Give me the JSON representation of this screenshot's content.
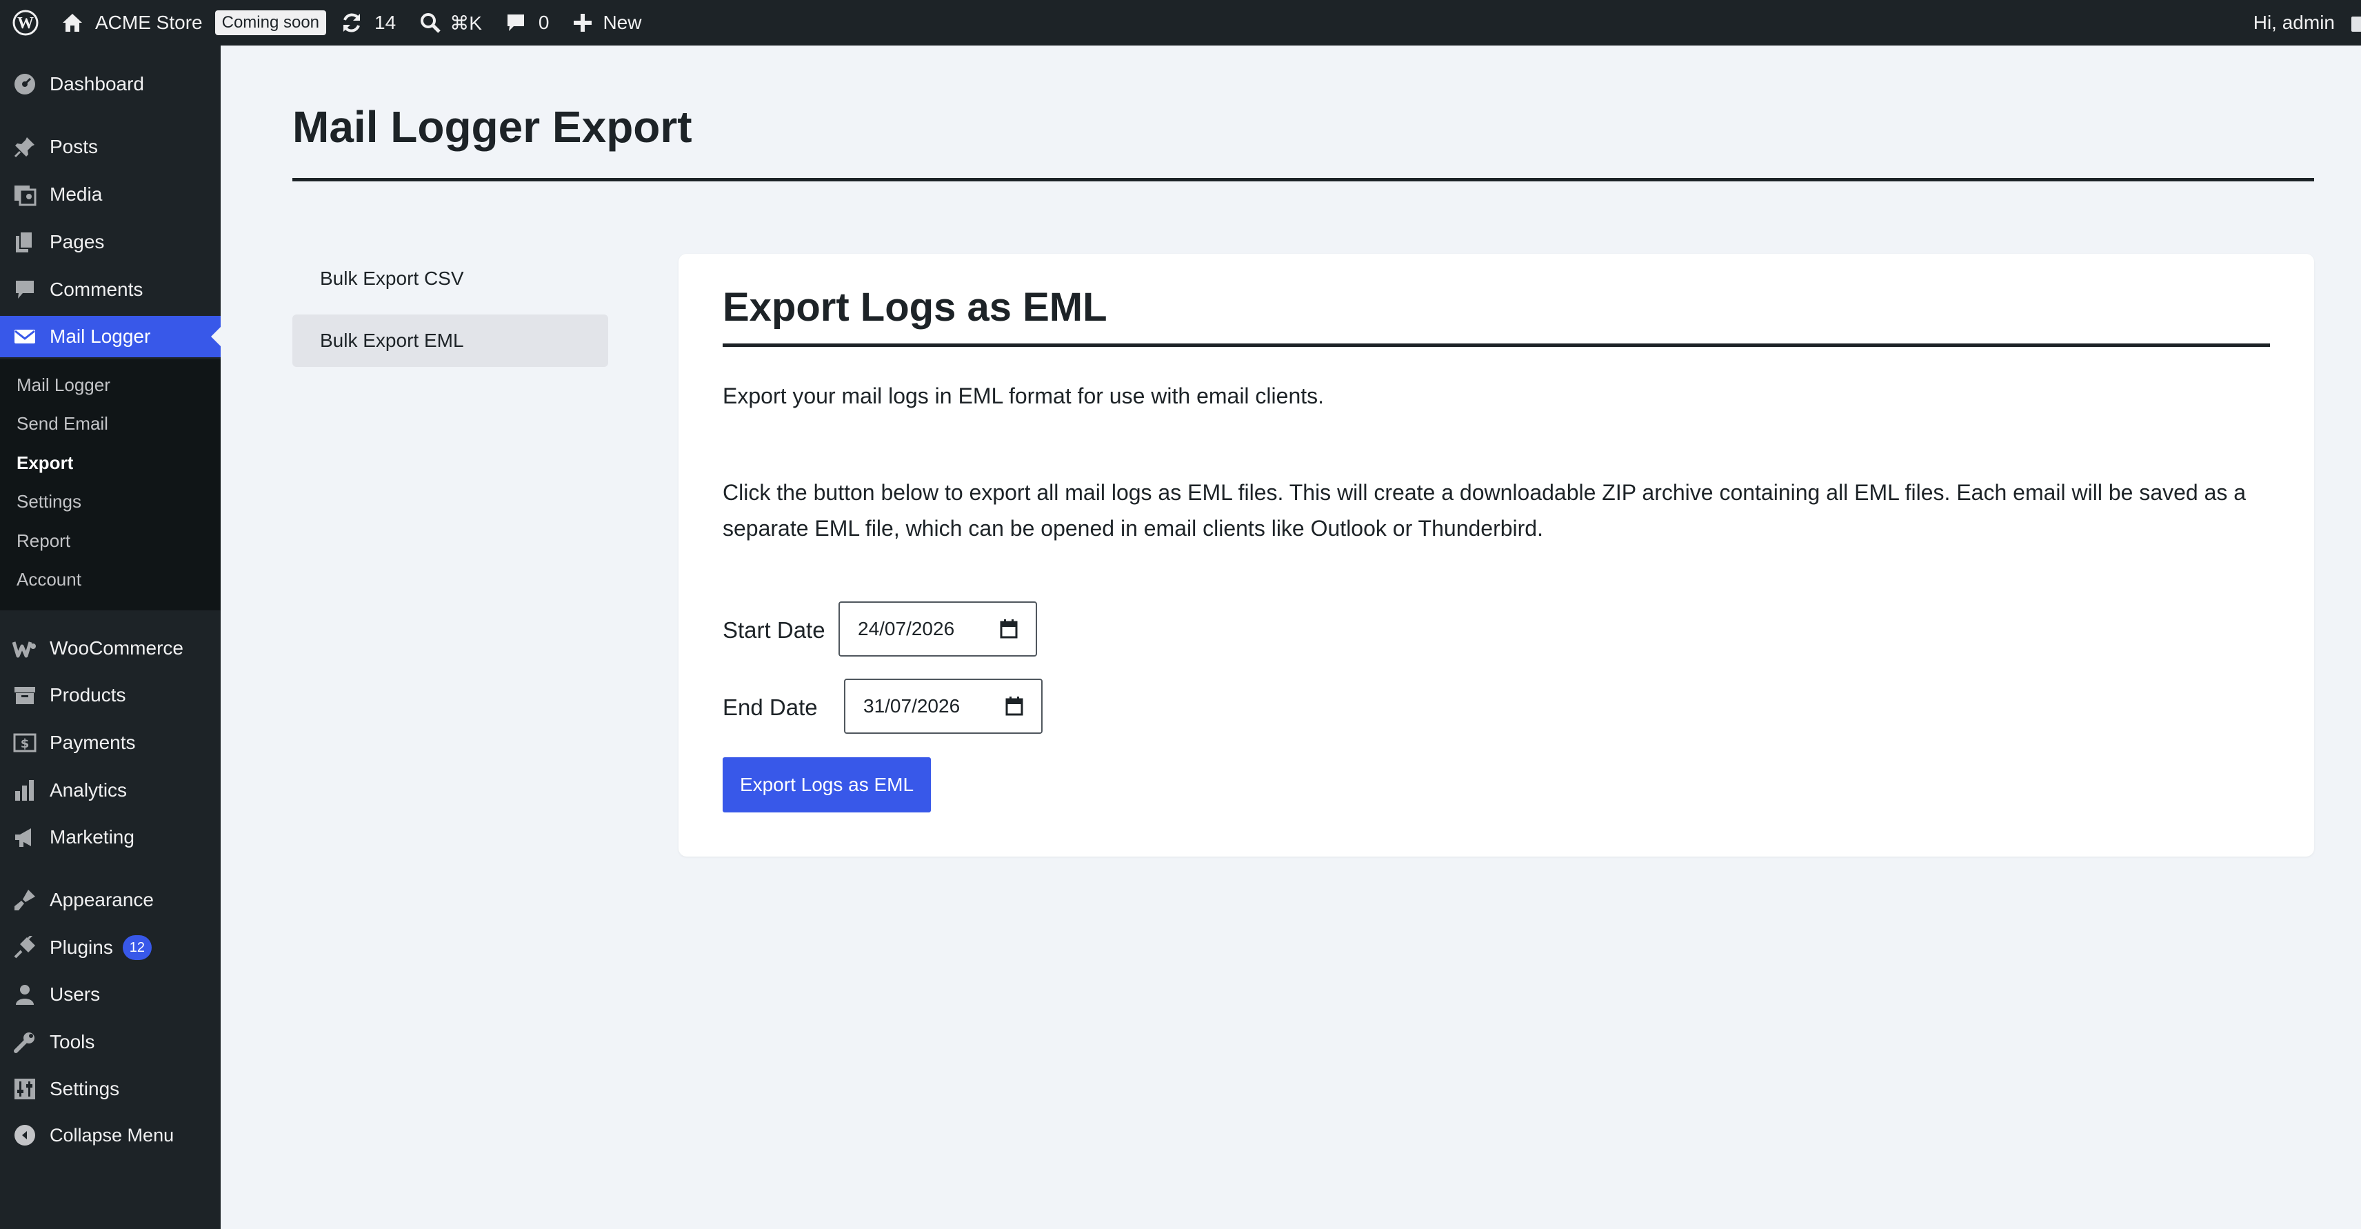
{
  "adminbar": {
    "site_name": "ACME Store",
    "coming_soon": "Coming soon",
    "updates_count": "14",
    "search_shortcut": "⌘K",
    "comments_count": "0",
    "new_label": "New",
    "greeting": "Hi, admin"
  },
  "sidebar": {
    "dashboard": "Dashboard",
    "posts": "Posts",
    "media": "Media",
    "pages": "Pages",
    "comments": "Comments",
    "mail_logger": "Mail Logger",
    "submenu": [
      "Mail Logger",
      "Send Email",
      "Export",
      "Settings",
      "Report",
      "Account"
    ],
    "current_submenu": "Export",
    "woocommerce": "WooCommerce",
    "products": "Products",
    "payments": "Payments",
    "analytics": "Analytics",
    "marketing": "Marketing",
    "appearance": "Appearance",
    "plugins": "Plugins",
    "plugins_badge": "12",
    "users": "Users",
    "tools": "Tools",
    "settings": "Settings",
    "collapse": "Collapse Menu"
  },
  "main": {
    "title": "Mail Logger Export",
    "tabs": [
      {
        "label": "Bulk Export CSV",
        "selected": false
      },
      {
        "label": "Bulk Export EML",
        "selected": true
      }
    ],
    "card": {
      "title": "Export Logs as EML",
      "intro": "Export your mail logs in EML format for use with email clients.",
      "description": "Click the button below to export all mail logs as EML files. This will create a downloadable ZIP archive containing all EML files. Each email will be saved as a separate EML file, which can be opened in email clients like Outlook or Thunderbird.",
      "start_label": "Start Date",
      "start_value": "24/07/2026",
      "end_label": "End Date",
      "end_value": "31/07/2026",
      "button_label": "Export Logs as EML"
    }
  },
  "colors": {
    "accent": "#3858e9",
    "adminbar_bg": "#1d2327",
    "submenu_bg": "#101517",
    "page_bg": "#f1f4f8"
  }
}
